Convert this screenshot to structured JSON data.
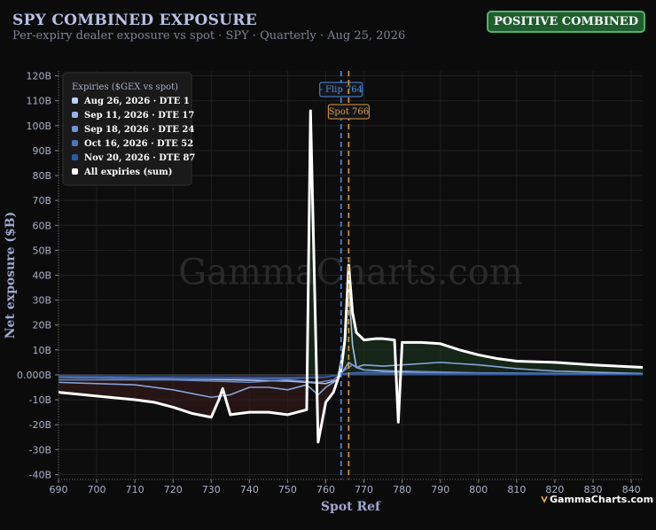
{
  "header": {
    "title": "SPY COMBINED EXPOSURE",
    "subtitle": "Per-expiry dealer exposure vs spot · SPY · Quarterly · Aug 25, 2026",
    "badge": "POSITIVE COMBINED"
  },
  "watermark": "GammaCharts.com",
  "brand": "GammaCharts.com",
  "colors": {
    "background": "#0b0b0b",
    "badge_bg": "#1f5d2d",
    "flip_line": "#4f8fe0",
    "spot_line": "#e09a3a",
    "sum_line": "#ffffff",
    "positive_fill": "#1e3a22",
    "negative_fill": "#3a1e1e"
  },
  "chart_data": {
    "type": "line",
    "title": "SPY COMBINED EXPOSURE",
    "xlabel": "Spot Ref",
    "ylabel": "Net exposure ($B)",
    "xlim": [
      690,
      843
    ],
    "ylim": [
      -42,
      122
    ],
    "x_ticks": [
      690,
      700,
      710,
      720,
      730,
      740,
      750,
      760,
      770,
      780,
      790,
      800,
      810,
      820,
      830,
      840
    ],
    "y_ticks": [
      -40,
      -30,
      -20,
      -10,
      0,
      10,
      20,
      30,
      40,
      50,
      60,
      70,
      80,
      90,
      100,
      110,
      120
    ],
    "y_tick_labels": [
      "-40B",
      "-30B",
      "-20B",
      "-10B",
      "0.000B",
      "10B",
      "20B",
      "30B",
      "40B",
      "50B",
      "60B",
      "70B",
      "80B",
      "90B",
      "100B",
      "110B",
      "120B"
    ],
    "grid": true,
    "legend_title": "Expiries ($GEX vs spot)",
    "legend_position": "top-left",
    "series": [
      {
        "name": "Aug 26, 2026 · DTE 1",
        "color": "#b9d3ff",
        "x": [
          690,
          720,
          750,
          760,
          763,
          765,
          766,
          767,
          768,
          770,
          780,
          800,
          843
        ],
        "y": [
          -1,
          -1.5,
          -2.5,
          -3.5,
          -2,
          14,
          36,
          12,
          3,
          2,
          1,
          0.5,
          0.2
        ]
      },
      {
        "name": "Sep 11, 2026 · DTE 17",
        "color": "#94b4ec",
        "x": [
          690,
          710,
          720,
          730,
          735,
          740,
          745,
          750,
          755,
          758,
          760,
          763,
          766,
          768,
          770,
          775,
          780,
          790,
          800,
          810,
          820,
          843
        ],
        "y": [
          -3,
          -4,
          -6,
          -9,
          -8,
          -5,
          -5,
          -6,
          -4,
          -8,
          -5,
          -2,
          5,
          3,
          4,
          3.5,
          4,
          5,
          4,
          2.5,
          1.5,
          0.5
        ]
      },
      {
        "name": "Sep 18, 2026 · DTE 24",
        "color": "#7093d4",
        "x": [
          690,
          720,
          740,
          750,
          758,
          762,
          765,
          767,
          770,
          780,
          800,
          843
        ],
        "y": [
          -2,
          -2,
          -3,
          -2,
          -3,
          -2,
          2,
          4,
          2,
          1.5,
          0.8,
          0.3
        ]
      },
      {
        "name": "Oct 16, 2026 · DTE 52",
        "color": "#4f74b8",
        "x": [
          690,
          720,
          750,
          760,
          765,
          770,
          790,
          843
        ],
        "y": [
          -1,
          -1.5,
          -1.5,
          -1,
          0.5,
          1,
          0.6,
          0.2
        ]
      },
      {
        "name": "Nov 20, 2026 · DTE 87",
        "color": "#2e58a6",
        "x": [
          690,
          720,
          750,
          760,
          765,
          770,
          790,
          843
        ],
        "y": [
          -0.5,
          -0.8,
          -1,
          -0.8,
          0.2,
          0.5,
          0.3,
          0.1
        ]
      },
      {
        "name": "All expiries (sum)",
        "color": "#ffffff",
        "x": [
          690,
          700,
          710,
          715,
          720,
          725,
          730,
          732,
          733,
          735,
          740,
          745,
          750,
          755,
          756,
          758,
          760,
          762,
          764,
          765,
          766,
          767,
          768,
          770,
          773,
          775,
          778,
          779,
          780,
          785,
          790,
          795,
          800,
          805,
          810,
          820,
          830,
          843
        ],
        "y": [
          -7,
          -8.5,
          -10,
          -11,
          -13,
          -15.5,
          -17,
          -10,
          -5.5,
          -16,
          -15,
          -15,
          -16,
          -14,
          106,
          -27,
          -11,
          -7,
          2,
          14,
          44,
          25,
          17,
          14,
          14.5,
          14.5,
          14,
          -19,
          13,
          13,
          12.5,
          10,
          8,
          6.5,
          5.5,
          5,
          4,
          3
        ]
      }
    ],
    "annotations": [
      {
        "label": "- Flip 764",
        "x": 764,
        "color": "#4f8fe0"
      },
      {
        "label": "Spot 766",
        "x": 766,
        "color": "#e09a3a"
      }
    ]
  }
}
